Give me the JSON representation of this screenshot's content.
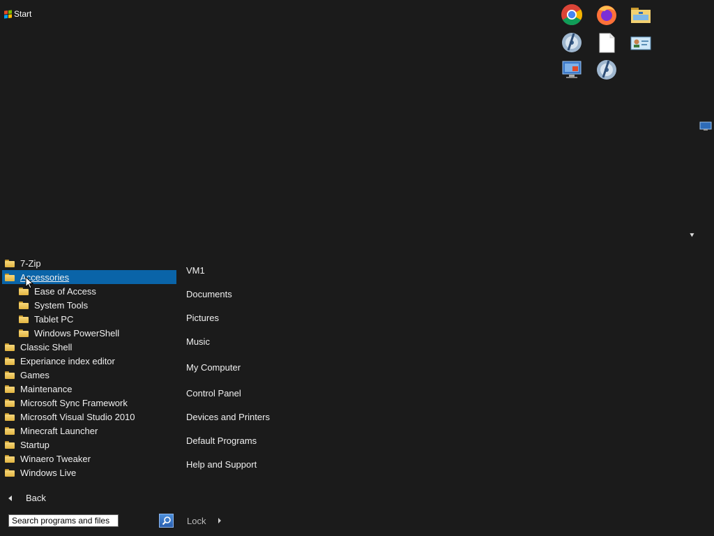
{
  "start": {
    "label": "Start"
  },
  "pinned_icons": [
    {
      "name": "chrome-icon"
    },
    {
      "name": "firefox-icon"
    },
    {
      "name": "file-explorer-icon"
    },
    {
      "name": "media-disc-icon"
    },
    {
      "name": "blank-document-icon"
    },
    {
      "name": "contact-card-icon"
    },
    {
      "name": "remote-desktop-icon"
    },
    {
      "name": "media-disc-icon"
    }
  ],
  "programs": [
    {
      "label": "7-Zip"
    },
    {
      "label": "Accessories",
      "selected": true
    },
    {
      "label": "Ease of Access",
      "indent": true
    },
    {
      "label": "System Tools",
      "indent": true
    },
    {
      "label": "Tablet PC",
      "indent": true
    },
    {
      "label": "Windows PowerShell",
      "indent": true
    },
    {
      "label": "Classic Shell"
    },
    {
      "label": "Experiance index editor"
    },
    {
      "label": "Games"
    },
    {
      "label": "Maintenance"
    },
    {
      "label": "Microsoft Sync Framework"
    },
    {
      "label": "Microsoft Visual Studio 2010"
    },
    {
      "label": "Minecraft Launcher"
    },
    {
      "label": "Startup"
    },
    {
      "label": "Winaero Tweaker"
    },
    {
      "label": "Windows Live"
    }
  ],
  "back": {
    "label": "Back"
  },
  "places": [
    {
      "label": "VM1"
    },
    {
      "label": "Documents"
    },
    {
      "label": "Pictures"
    },
    {
      "label": "Music"
    },
    {
      "label": "My Computer"
    },
    {
      "label": "Control Panel"
    },
    {
      "label": "Devices and Printers"
    },
    {
      "label": "Default Programs"
    },
    {
      "label": "Help and Support"
    }
  ],
  "search": {
    "placeholder": "Search programs and files"
  },
  "lock": {
    "label": "Lock"
  },
  "colors": {
    "background": "#1b1b1b",
    "selection": "#0a64a8"
  }
}
